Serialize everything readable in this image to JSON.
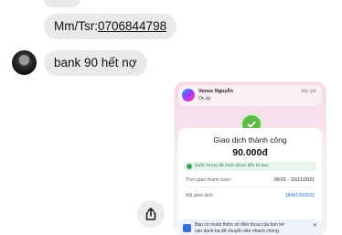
{
  "chat": {
    "account_prefix": "Mm/Tsr:",
    "account_number": "0706844798",
    "message": "bank 90 hết nợ"
  },
  "screenshot": {
    "notification": {
      "sender": "Venus Nguyễn",
      "subtitle": "Ổn ấy",
      "time": "bây giờ"
    },
    "status": "Giao dịch thành công",
    "amount": "90.000đ",
    "info_text": "Quốc Hưng đã nhận được tiền từ bạn",
    "rows": [
      {
        "label": "Thời gian thanh toán",
        "value": "09:01 - 16/11/2021"
      },
      {
        "label": "Mã giao dịch",
        "value": "18491092832"
      }
    ],
    "promo": {
      "line1": "Bạn có muốn thêm số điện thoại của bạn bè",
      "line2": "vào danh bạ để chuyển tiền nhanh chóng"
    }
  },
  "colors": {
    "bubble": "#e9e9eb",
    "success": "#5fb848",
    "link": "#1e6fd9"
  },
  "icons": [
    "messenger-icon",
    "check-icon",
    "info-icon",
    "close-icon",
    "share-icon"
  ]
}
